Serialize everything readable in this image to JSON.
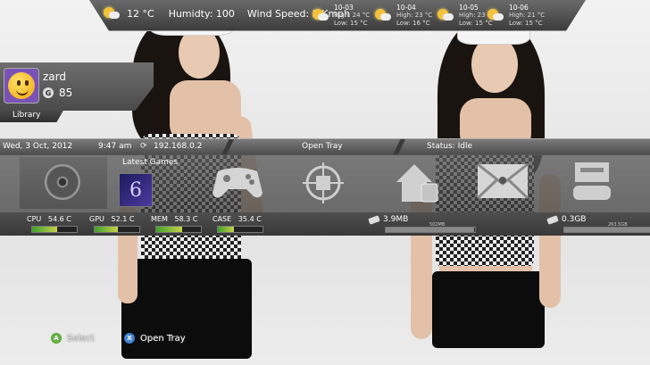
{
  "weather": {
    "current_temp": "12 °C",
    "humidity": "Humidty: 100",
    "wind": "Wind Speed: 2 Kmph",
    "forecast": [
      {
        "date": "10-03",
        "high": "High:  24 °C",
        "low": "Low:   15 °C"
      },
      {
        "date": "10-04",
        "high": "High:  23 °C",
        "low": "Low:   16 °C"
      },
      {
        "date": "10-05",
        "high": "High:  23 °C",
        "low": "Low:   15 °C"
      },
      {
        "date": "10-06",
        "high": "High:  21 °C",
        "low": "Low:   15 °C"
      }
    ],
    "icon": "partly-cloudy-icon"
  },
  "profile": {
    "gamertag": "zard",
    "gamerscore": "85",
    "gamerscore_icon": "G",
    "library_label": "Library"
  },
  "status_bar": {
    "date": "Wed, 3 Oct, 2012",
    "time": "9:47 am",
    "ip": "192.168.0.2",
    "tray": "Open Tray",
    "status": "Status: Idle"
  },
  "dashboard": {
    "latest_games_label": "Latest Games",
    "game_cover_text": "6",
    "tiles": [
      "disc-icon",
      "controller-icon",
      "crosshair-icon",
      "home-icon",
      "envelope-icon",
      "console-icon"
    ]
  },
  "meters": [
    {
      "label": "CPU",
      "value": "54.6 C",
      "level": 0.55
    },
    {
      "label": "GPU",
      "value": "52.1 C",
      "level": 0.52
    },
    {
      "label": "MEM",
      "value": "58.3 C",
      "level": 0.58
    },
    {
      "label": "CASE",
      "value": "35.4 C",
      "level": 0.35
    }
  ],
  "drives": [
    {
      "free": "3.9MB",
      "total": "502MB",
      "used": 0.99
    },
    {
      "free": "0.3GB",
      "total": "263.5GB",
      "used": 0.99
    }
  ],
  "hints": {
    "a_label": "Select",
    "x_label": "Open Tray",
    "a_button": "A",
    "x_button": "X"
  }
}
